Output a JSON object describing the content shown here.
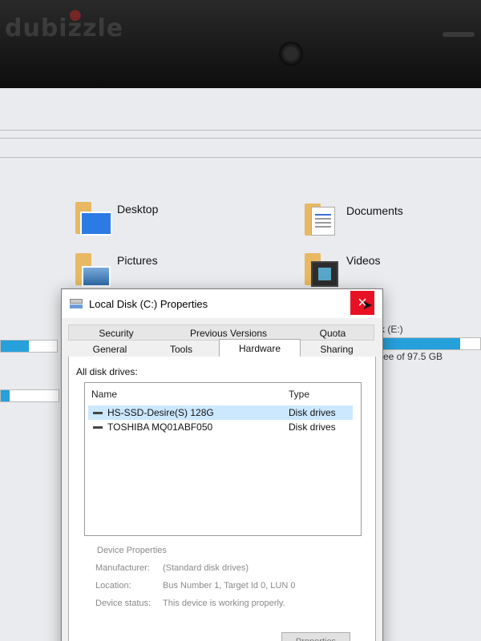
{
  "watermark": "dubizzle",
  "explorer": {
    "folders": [
      {
        "label": "Desktop",
        "icon": "desktop-folder-icon"
      },
      {
        "label": "Documents",
        "icon": "documents-folder-icon"
      },
      {
        "label": "Pictures",
        "icon": "pictures-folder-icon"
      },
      {
        "label": "Videos",
        "icon": "videos-folder-icon"
      }
    ],
    "drive_e_label": "k (E:)",
    "drive_e_free": "ree of 97.5 GB"
  },
  "dialog": {
    "title": "Local Disk (C:) Properties",
    "close_icon": "×",
    "tabs_row1": [
      "Security",
      "Previous Versions",
      "Quota"
    ],
    "tabs_row2": [
      "General",
      "Tools",
      "Hardware",
      "Sharing"
    ],
    "active_tab": "Hardware",
    "all_disk_drives_label": "All disk drives:",
    "list": {
      "columns": [
        "Name",
        "Type"
      ],
      "rows": [
        {
          "name": "HS-SSD-Desire(S) 128G",
          "type": "Disk drives"
        },
        {
          "name": "TOSHIBA MQ01ABF050",
          "type": "Disk drives"
        }
      ]
    },
    "device_properties": {
      "title": "Device Properties",
      "manufacturer_label": "Manufacturer:",
      "manufacturer": "(Standard disk drives)",
      "location_label": "Location:",
      "location": "Bus Number 1, Target Id 0, LUN 0",
      "status_label": "Device status:",
      "status": "This device is working properly."
    },
    "properties_button": "Properties"
  },
  "colors": {
    "accent": "#26a0da",
    "close_red": "#e81123",
    "selection": "#cce8ff"
  }
}
